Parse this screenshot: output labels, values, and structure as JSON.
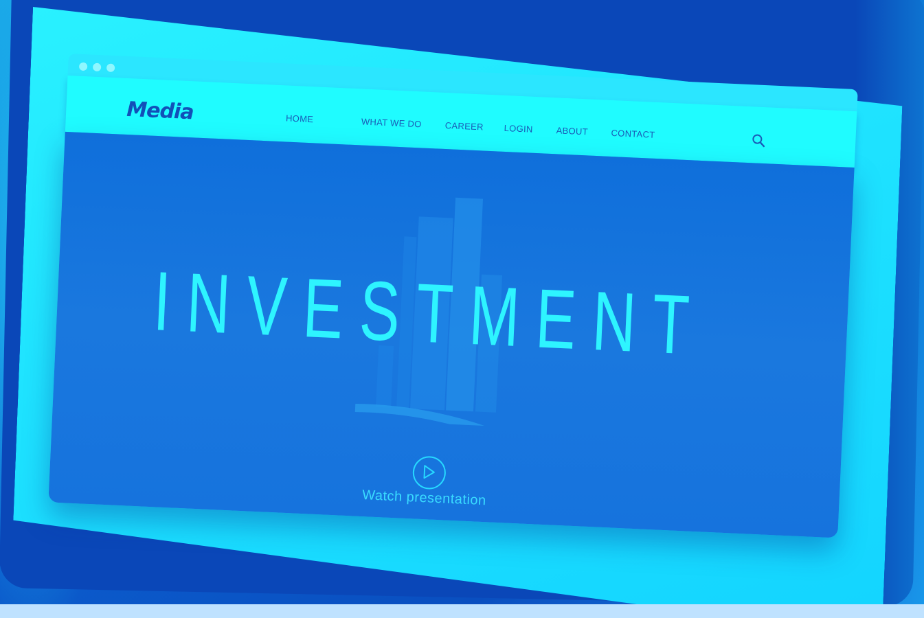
{
  "browser": {
    "window_dots": [
      "dot-1",
      "dot-2",
      "dot-3"
    ]
  },
  "navbar": {
    "logo": "Media",
    "items": [
      {
        "label": "HOME"
      },
      {
        "label": "WHAT WE DO"
      },
      {
        "label": "CAREER"
      },
      {
        "label": "LOGIN"
      },
      {
        "label": "ABOUT"
      },
      {
        "label": "CONTACT"
      }
    ],
    "search_icon": "search-icon"
  },
  "hero": {
    "title": "INVESTMENT",
    "play_icon": "play-icon",
    "watch_label": "Watch presentation"
  },
  "colors": {
    "screen": "#1ee2ff",
    "navbar": "#1ffcff",
    "hero": "#1673dd",
    "title": "#2ef4ff",
    "logo": "#1250b8"
  }
}
